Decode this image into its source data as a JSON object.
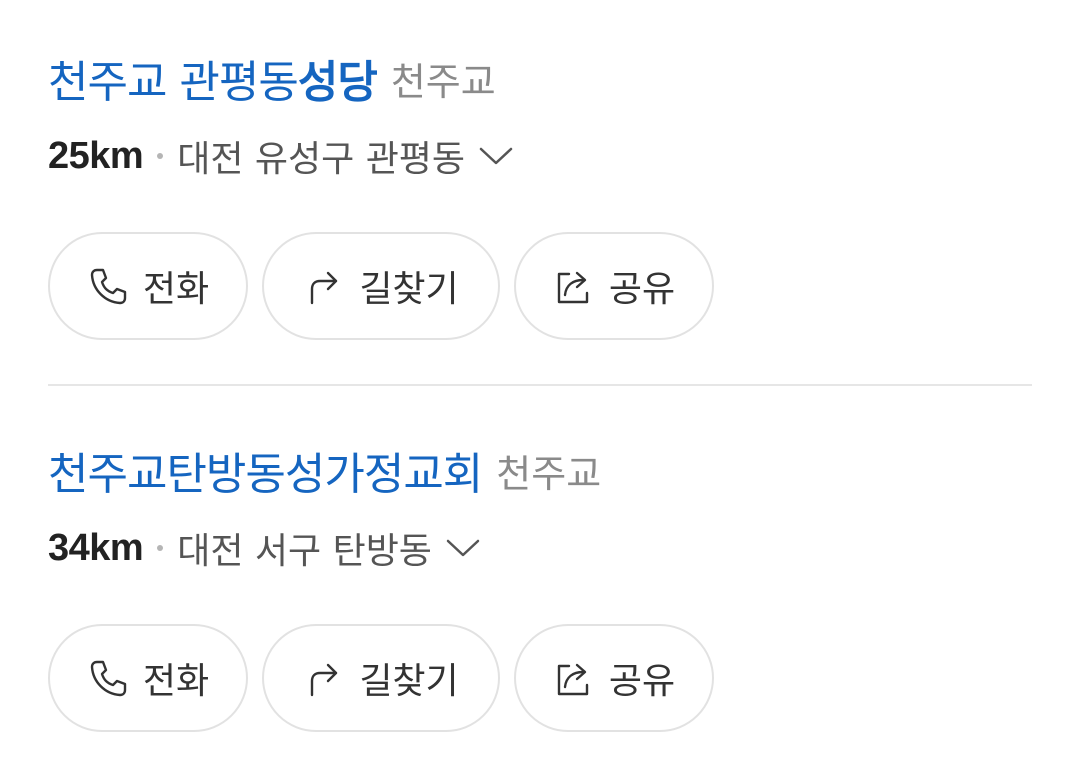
{
  "results": [
    {
      "name_plain": "천주교 관평동",
      "name_highlight": "성당",
      "category": "천주교",
      "distance": "25km",
      "address": "대전 유성구 관평동",
      "actions": {
        "call": "전화",
        "route": "길찾기",
        "share": "공유"
      }
    },
    {
      "name_plain": "천주교탄방동성가정교회",
      "name_highlight": "",
      "category": "천주교",
      "distance": "34km",
      "address": "대전 서구 탄방동",
      "actions": {
        "call": "전화",
        "route": "길찾기",
        "share": "공유"
      }
    }
  ],
  "icons": {
    "call": "phone-icon",
    "route": "turn-right-arrow-icon",
    "share": "share-icon",
    "expand": "chevron-down-icon"
  },
  "colors": {
    "title": "#1565c0",
    "category": "#8a8a8a",
    "distance": "#222222",
    "address": "#555555",
    "border": "#e2e2e2"
  }
}
